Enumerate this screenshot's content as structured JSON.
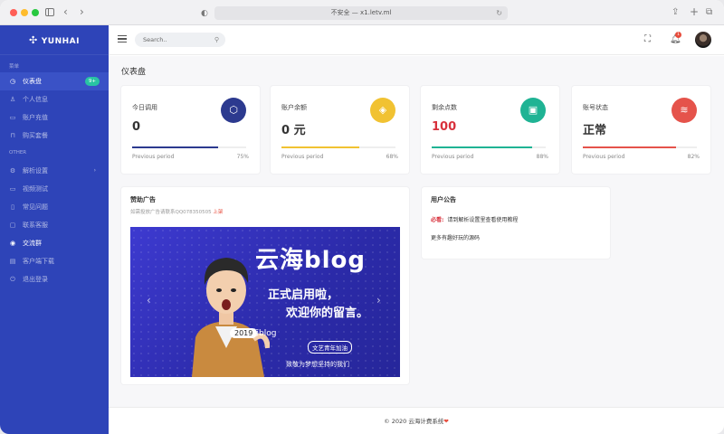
{
  "browser": {
    "url_text": "不安全 — x1.letv.ml"
  },
  "sidebar": {
    "brand": "YUNHAI",
    "section_main": "菜单",
    "section_other": "OTHER",
    "items": [
      {
        "label": "仪表盘",
        "badge": "9+"
      },
      {
        "label": "个人信息"
      },
      {
        "label": "账户充值"
      },
      {
        "label": "购买套餐"
      },
      {
        "label": "解析设置"
      },
      {
        "label": "视频测试"
      },
      {
        "label": "常见问题"
      },
      {
        "label": "联系客服"
      },
      {
        "label": "交流群"
      },
      {
        "label": "客户端下载"
      },
      {
        "label": "退出登录"
      }
    ]
  },
  "topbar": {
    "search_placeholder": "Search..",
    "notification_count": "1"
  },
  "main": {
    "title": "仪表盘",
    "stats": [
      {
        "label": "今日调用",
        "value": "0",
        "period": "Previous period",
        "percent": "75%",
        "progress": 0.75,
        "color": "#2c3a8f",
        "icon": "cube-icon"
      },
      {
        "label": "账户余额",
        "value": "0 元",
        "period": "Previous period",
        "percent": "68%",
        "progress": 0.68,
        "color": "#f1c232",
        "icon": "tag-icon"
      },
      {
        "label": "剩余点数",
        "value": "100",
        "period": "Previous period",
        "percent": "88%",
        "progress": 0.88,
        "color": "#1fb394",
        "icon": "clipboard-icon"
      },
      {
        "label": "账号状态",
        "value": "正常",
        "period": "Previous period",
        "percent": "82%",
        "progress": 0.82,
        "color": "#e5534b",
        "icon": "layers-icon"
      }
    ],
    "ad": {
      "title": "赞助广告",
      "subtitle": "如需投放广告请联系QQ078350505",
      "subtitle_highlight": "上架",
      "banner_big": "云海blog",
      "banner_line1": "正式启用啦，",
      "banner_line2": "欢迎你的留言。",
      "banner_small1": "云海blog",
      "banner_year": "2019",
      "banner_tag": "文艺青年加油",
      "banner_small2": "致敬为梦想坚持的我们"
    },
    "notice": {
      "title": "用户公告",
      "line1_tag": "必看:",
      "line1_text": "请到解析设置里查看使用教程",
      "line2_text": "更多有趣好玩的源码"
    }
  },
  "footer": {
    "text": "© 2020 云海计费系统"
  }
}
